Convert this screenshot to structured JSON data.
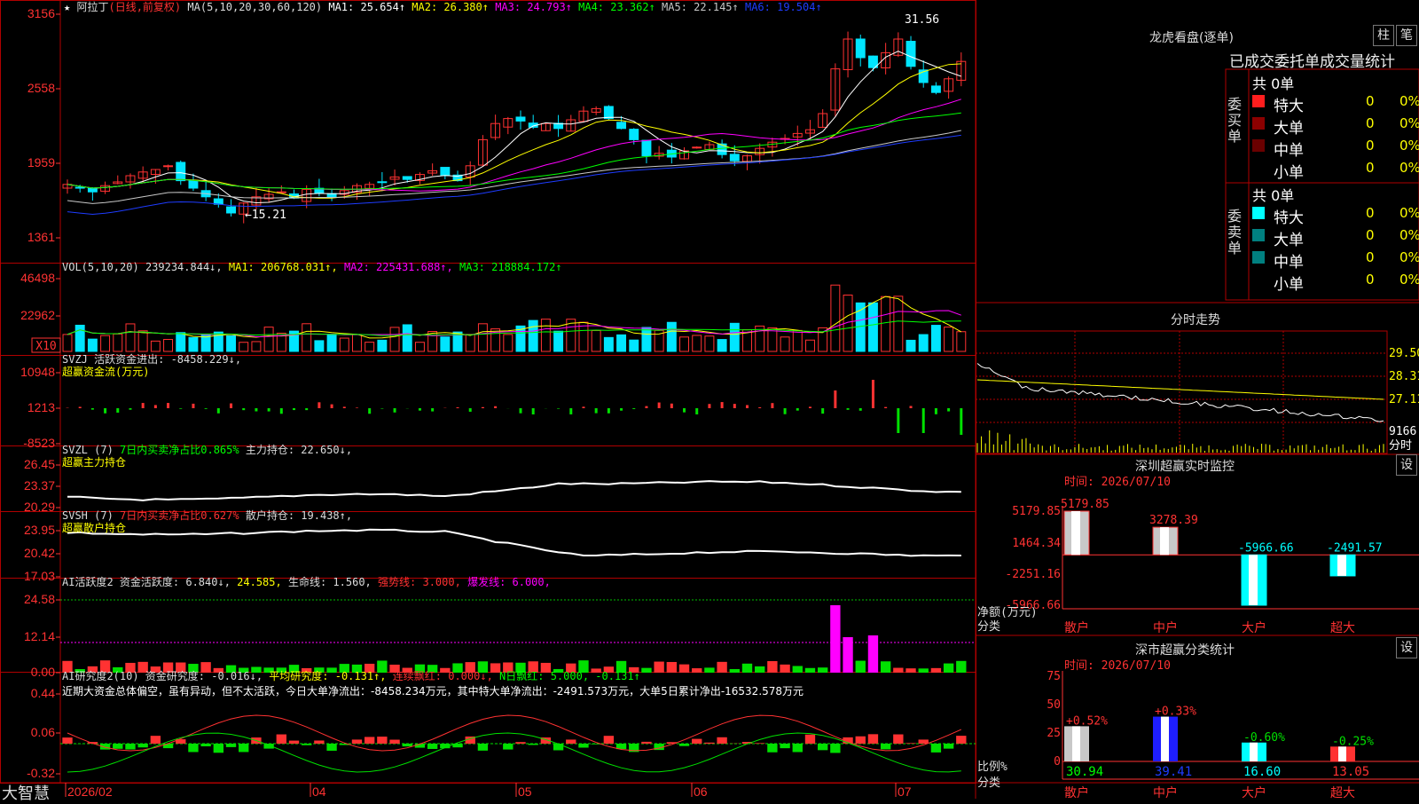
{
  "app": {
    "brand": "大智慧"
  },
  "stock": {
    "name": "阿拉丁",
    "period": "(日线,前复权)"
  },
  "colors": {
    "up": "#ff3232",
    "down": "#00e5ff",
    "ma1": "#ffffff",
    "ma2": "#ffff00",
    "ma3": "#ff00ff",
    "ma4": "#00ff00",
    "ma5": "#c8c8c8",
    "ma6": "#1e3cff",
    "grid": "#b00000"
  },
  "kline": {
    "indicator_label": "MA(5,10,20,30,60,120)",
    "ma_values": [
      {
        "label": "MA1: 25.654↑",
        "color": "#ffffff"
      },
      {
        "label": "MA2: 26.380↑",
        "color": "#ffff00"
      },
      {
        "label": "MA3: 24.793↑",
        "color": "#ff00ff"
      },
      {
        "label": "MA4: 23.362↑",
        "color": "#00ff00"
      },
      {
        "label": "MA5: 22.145↑",
        "color": "#c8c8c8"
      },
      {
        "label": "MA6: 19.504↑",
        "color": "#1e3cff"
      }
    ],
    "y_ticks": [
      "3156",
      "2558",
      "1959",
      "1361"
    ],
    "high_label": "31.56",
    "low_label": "←15.21",
    "prices": [
      17.9,
      17.6,
      17.3,
      17.8,
      18.1,
      18.6,
      18.9,
      19.1,
      19.4,
      18.2,
      17.6,
      16.9,
      16.3,
      15.6,
      16.4,
      16.9,
      17.1,
      17.3,
      16.8,
      17.5,
      17.2,
      16.9,
      17.4,
      17.8,
      17.9,
      18.1,
      18.5,
      18.3,
      18.7,
      19.0,
      18.6,
      18.2,
      19.4,
      21.5,
      22.8,
      23.2,
      23.0,
      22.5,
      22.8,
      22.4,
      23.1,
      23.8,
      24.0,
      23.2,
      22.4,
      21.5,
      20.2,
      20.4,
      20.1,
      20.6,
      20.9,
      21.1,
      20.3,
      19.8,
      20.2,
      20.8,
      21.3,
      21.6,
      22.0,
      22.3,
      23.6,
      27.2,
      29.6,
      28.1,
      27.3,
      28.5,
      29.6,
      27.4,
      26.1,
      25.3,
      26.4,
      27.8
    ]
  },
  "volume": {
    "label": "VOL(5,10,20)",
    "value": "239234.844↓,",
    "ma1": "MA1: 206768.031↑,",
    "ma2": "MA2: 225431.688↑,",
    "ma3": "MA3: 218884.172↑",
    "y_ticks": [
      "46498",
      "22962"
    ],
    "unit": "X10"
  },
  "svzj": {
    "label": "SVZJ  活跃资金进出: -8458.229↓,",
    "sub": "超赢资金流(万元)",
    "y_ticks": [
      "10948",
      "1213",
      "-8523"
    ]
  },
  "svzl": {
    "label": "SVZL (7)",
    "ratio": "7日内买卖净占比0.865%",
    "pos": "主力持仓: 22.650↓,",
    "sub": "超赢主力持仓",
    "y_ticks": [
      "26.45",
      "23.37",
      "20.29"
    ]
  },
  "svsh": {
    "label": "SVSH (7)",
    "ratio": "7日内买卖净占比0.627%",
    "pos": "散户持仓: 19.438↑,",
    "sub": "超赢散户持仓",
    "y_ticks": [
      "23.95",
      "20.42",
      "17.03"
    ]
  },
  "active": {
    "label": "AI活跃度2 资金活跃度: 6.840↓,",
    "v2": "24.585,",
    "life": "生命线: 1.560,",
    "strong": "强势线: 3.000,",
    "burst": "爆发线: 6.000,",
    "y_ticks": [
      "24.58",
      "12.14",
      "0.00"
    ]
  },
  "research": {
    "label": "AI研究度2(10) 资金研究度: -0.016↓,",
    "avg": "平均研究度: -0.131↑,",
    "cont": "连续飘红: 0.000↓,",
    "nday": "N日飘红: 5.000, -0.131↑",
    "comment": "近期大资金总体偏空，虽有异动，但不太活跃，今日大单净流出：-8458.234万元，其中特大单净流出：-2491.573万元，大单5日累计净出-16532.578万元",
    "y_ticks": [
      "0.44",
      "0.06",
      "-0.32"
    ]
  },
  "x_axis": [
    "2026/02",
    "04",
    "05",
    "06",
    "07"
  ],
  "dragon": {
    "title": "龙虎看盘(逐单)",
    "btn_bar": "柱",
    "btn_note": "笔",
    "tabs": [
      "已成交",
      "委托单",
      "成交量统计"
    ],
    "buy": {
      "side": "委买单",
      "total": "共 0单",
      "rows": [
        {
          "name": "特大",
          "count": "0",
          "pct": "0%",
          "color": "#ff1e1e"
        },
        {
          "name": "大单",
          "count": "0",
          "pct": "0%",
          "color": "#8c0000"
        },
        {
          "name": "中单",
          "count": "0",
          "pct": "0%",
          "color": "#6a0000"
        },
        {
          "name": "小单",
          "count": "0",
          "pct": "0%",
          "color": ""
        }
      ]
    },
    "sell": {
      "side": "委卖单",
      "total": "共 0单",
      "rows": [
        {
          "name": "特大",
          "count": "0",
          "pct": "0%",
          "color": "#00ffff"
        },
        {
          "name": "大单",
          "count": "0",
          "pct": "0%",
          "color": "#008080"
        },
        {
          "name": "中单",
          "count": "0",
          "pct": "0%",
          "color": "#008080"
        },
        {
          "name": "小单",
          "count": "0",
          "pct": "0%",
          "color": ""
        }
      ]
    }
  },
  "intraday": {
    "title": "分时走势",
    "y_labels": [
      "29.50",
      "28.31",
      "27.11",
      "9166"
    ],
    "unit": "分时"
  },
  "monitor": {
    "title": "深圳超赢实时监控",
    "setting": "设",
    "time": "时间: 2026/07/10",
    "y_ticks": [
      "5179.85",
      "1464.34",
      "-2251.16",
      "-5966.66"
    ],
    "axis_label": "净额(万元)",
    "axis_label2": "分类",
    "bars": [
      {
        "cat": "散户",
        "value": 5179.85,
        "label": "5179.85"
      },
      {
        "cat": "中户",
        "value": 3278.39,
        "label": "3278.39"
      },
      {
        "cat": "大户",
        "value": -5966.66,
        "label": "-5966.66"
      },
      {
        "cat": "超大",
        "value": -2491.57,
        "label": "-2491.57"
      }
    ]
  },
  "category": {
    "title": "深市超赢分类统计",
    "setting": "设",
    "time": "时间: 2026/07/10",
    "y_ticks": [
      "75",
      "50",
      "25",
      "0"
    ],
    "axis_label": "比例%",
    "axis_label2": "分类",
    "bars": [
      {
        "cat": "散户",
        "value": 30.94,
        "label": "30.94",
        "change": "+0.52%"
      },
      {
        "cat": "中户",
        "value": 39.41,
        "label": "39.41",
        "change": "+0.33%"
      },
      {
        "cat": "大户",
        "value": 16.6,
        "label": "16.60",
        "change": "-0.60%"
      },
      {
        "cat": "超大",
        "value": 13.05,
        "label": "13.05",
        "change": "-0.25%"
      }
    ]
  }
}
